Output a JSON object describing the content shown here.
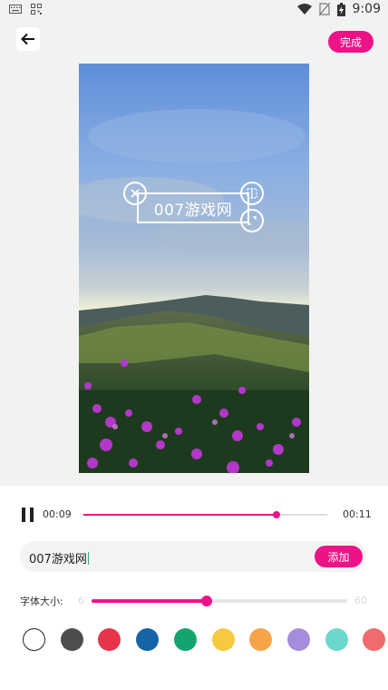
{
  "status_bar": {
    "time": "9:09"
  },
  "header": {
    "done_label": "完成"
  },
  "sticker": {
    "text": "007游戏网"
  },
  "player": {
    "current_time": "00:09",
    "total_time": "00:11",
    "progress": 0.79
  },
  "text_input": {
    "value": "007游戏网",
    "add_label": "添加"
  },
  "font_size": {
    "label": "字体大小:",
    "min": "6",
    "max": "60",
    "value_fraction": 0.45
  },
  "colors": [
    "#ffffff",
    "#4d4d4d",
    "#e8344a",
    "#1565a6",
    "#14a56e",
    "#f8c93e",
    "#f5a448",
    "#a78bdc",
    "#6ad9cb",
    "#f06b6b"
  ],
  "accent": "#ee1288"
}
